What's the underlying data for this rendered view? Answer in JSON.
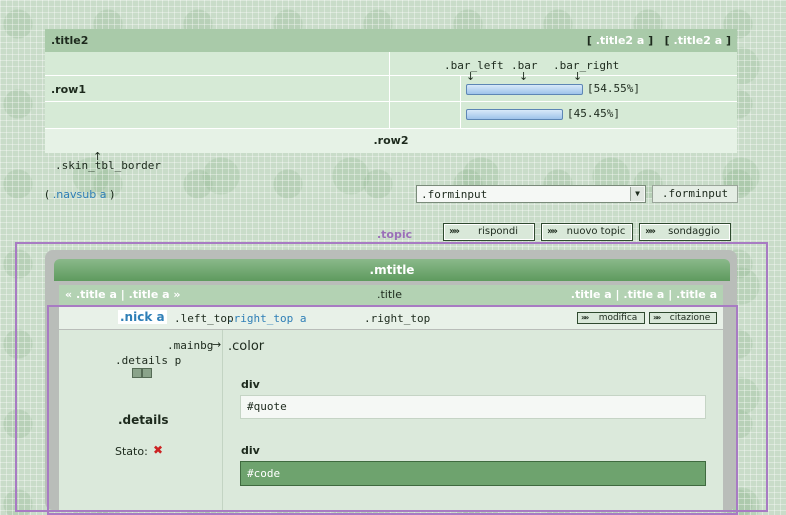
{
  "stats": {
    "title2": ".title2",
    "title2_links": [
      ".title2 a",
      ".title2 a"
    ],
    "bar_labels": {
      "bar_left": ".bar_left",
      "bar": ".bar",
      "bar_right": ".bar_right"
    },
    "row1_label": ".row1",
    "rows": [
      {
        "percent": "[54.55%]",
        "fill": 0.5455
      },
      {
        "percent": "[45.45%]",
        "fill": 0.4545
      }
    ],
    "row2_label": ".row2",
    "border_label": ".skin_tbl_border"
  },
  "navsub": {
    "open": "(",
    "link": ".navsub a",
    "close": ")"
  },
  "form": {
    "select_value": ".forminput",
    "button_label": ".forminput"
  },
  "topic_label": ".topic",
  "actions": {
    "reply": "rispondi",
    "new_topic": "nuovo topic",
    "poll": "sondaggio"
  },
  "post": {
    "mtitle": ".mtitle",
    "breadcrumb": {
      "left_link1": ".title a",
      "left_link2": ".title a",
      "center": ".title",
      "right_links": [
        ".title a",
        ".title a",
        ".title a"
      ]
    },
    "nick": ".nick a",
    "left_top": ".left_top",
    "right_top_a": ".right_top a",
    "right_top": ".right_top",
    "edit_button": "modifica",
    "quote_button": "citazione",
    "mainbg": ".mainbg",
    "details_p": ".details p",
    "details": ".details",
    "status_label": "Stato:",
    "color_label": ".color",
    "quote_heading": "div",
    "quote_text": "#quote",
    "code_heading": "div",
    "code_text": "#code"
  },
  "colors": {
    "accent": "#2f7fb7",
    "topic_border": "#a87bc3",
    "code_bg": "#6ea36e"
  }
}
